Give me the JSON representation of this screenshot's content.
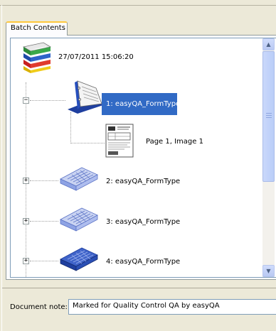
{
  "tab": {
    "label": "Batch Contents"
  },
  "tree": {
    "batch": {
      "label": "27/07/2011 15:06:20",
      "icon": "batch-trays-icon"
    },
    "documents": [
      {
        "label": "1: easyQA_FormType",
        "expander": "−",
        "selected": true,
        "icon": "open-binder-icon",
        "pages": [
          {
            "label": "Page 1, Image 1",
            "icon": "page-thumbnail-icon"
          }
        ]
      },
      {
        "label": "2: easyQA_FormType",
        "expander": "+",
        "selected": false,
        "icon": "closed-binder-icon"
      },
      {
        "label": "3: easyQA_FormType",
        "expander": "+",
        "selected": false,
        "icon": "closed-binder-icon"
      },
      {
        "label": "4: easyQA_FormType",
        "expander": "+",
        "selected": false,
        "icon": "closed-binder-dark-icon"
      }
    ]
  },
  "scrollbar": {
    "up": "▲",
    "down": "▼"
  },
  "note": {
    "label": "Document note:",
    "value": "Marked for Quality Control QA by easyQA"
  },
  "colors": {
    "selection": "#316ac5",
    "tab_highlight": "#ffc83c",
    "window_bg": "#ece9d8"
  }
}
